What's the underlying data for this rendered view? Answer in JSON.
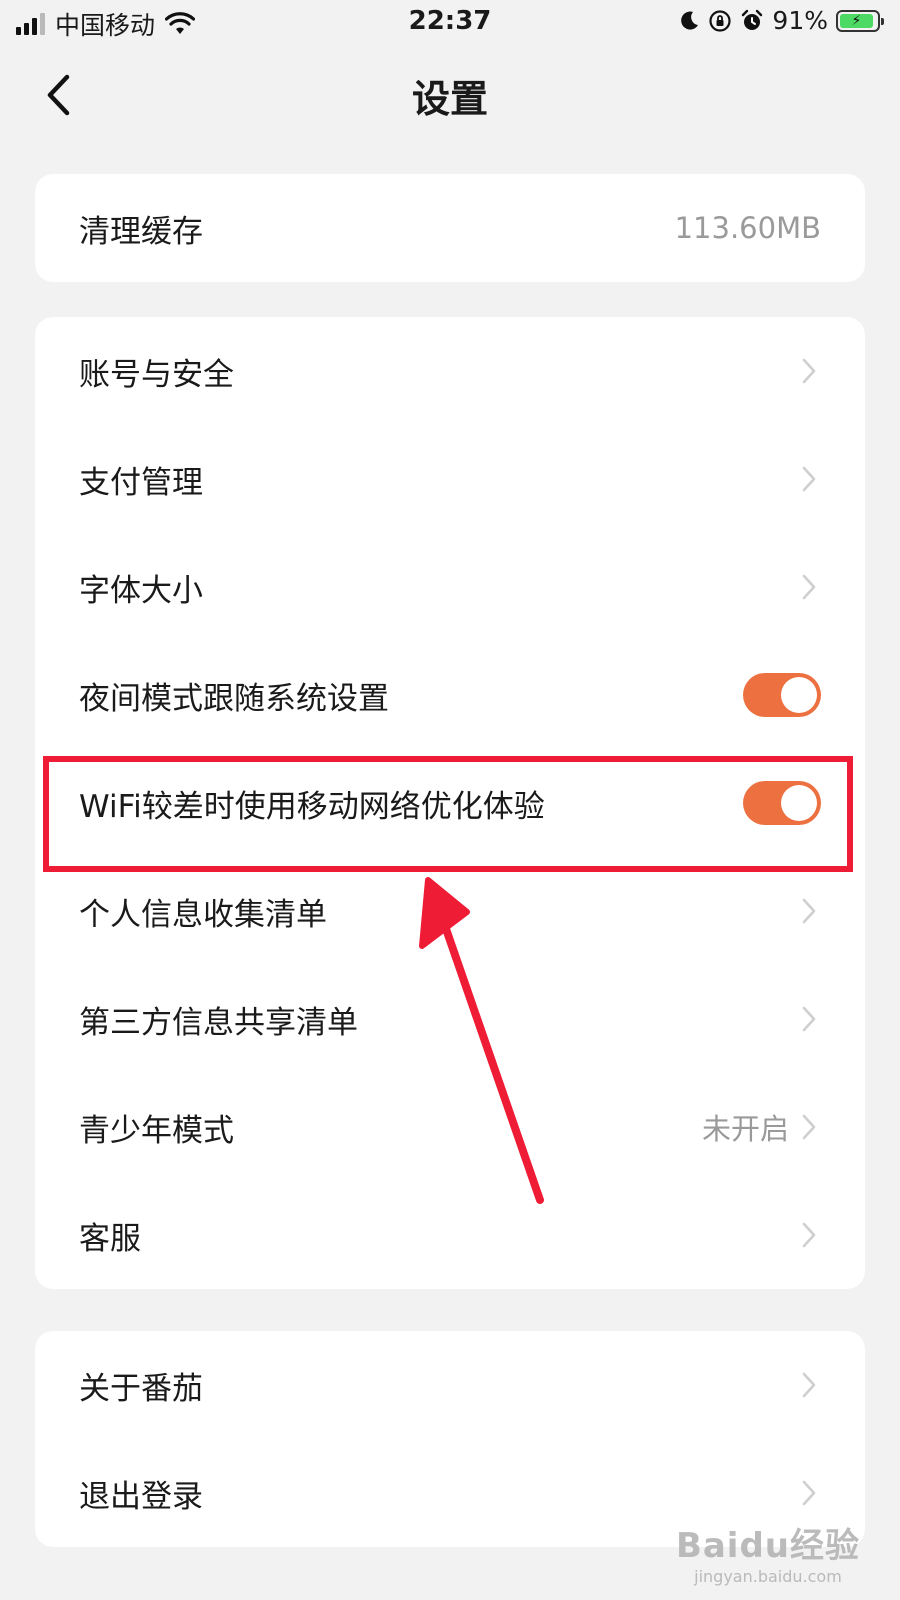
{
  "status_bar": {
    "carrier": "中国移动",
    "time": "22:37",
    "battery_percent": "91%",
    "battery_level": 0.91
  },
  "header": {
    "title": "设置"
  },
  "cache_card": {
    "label": "清理缓存",
    "value": "113.60MB"
  },
  "settings": {
    "items": [
      {
        "label": "账号与安全"
      },
      {
        "label": "支付管理"
      },
      {
        "label": "字体大小"
      },
      {
        "label": "夜间模式跟随系统设置",
        "toggle_on": true
      },
      {
        "label": "WiFi较差时使用移动网络优化体验",
        "toggle_on": true
      },
      {
        "label": "个人信息收集清单"
      },
      {
        "label": "第三方信息共享清单"
      },
      {
        "label": "青少年模式",
        "value": "未开启"
      },
      {
        "label": "客服"
      }
    ]
  },
  "bottom_card": {
    "items": [
      {
        "label": "关于番茄"
      },
      {
        "label": "退出登录"
      }
    ]
  },
  "colors": {
    "accent": "#ec7040",
    "annotation": "#ef1c35",
    "background": "#f2f2f2"
  },
  "watermark": {
    "brand": "Baidu经验",
    "url": "jingyan.baidu.com"
  }
}
